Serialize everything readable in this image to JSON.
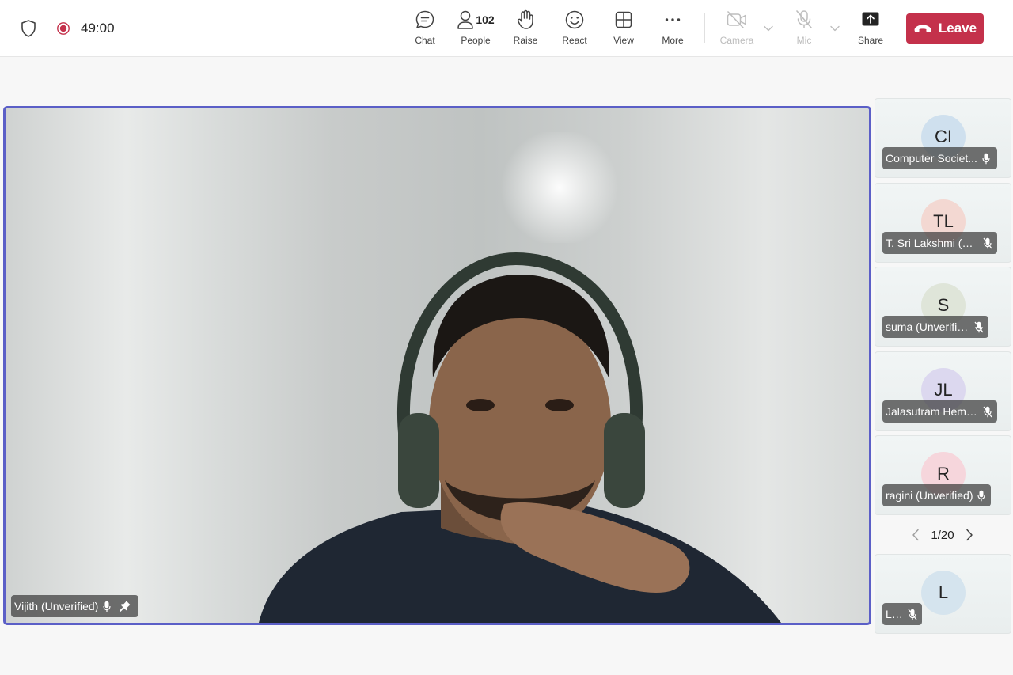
{
  "status": {
    "timer": "49:00"
  },
  "toolbar": {
    "chat": "Chat",
    "people": "People",
    "people_count": "102",
    "raise": "Raise",
    "react": "React",
    "view": "View",
    "more": "More",
    "camera": "Camera",
    "mic": "Mic",
    "share": "Share",
    "leave": "Leave"
  },
  "main_video": {
    "participant": "Vijith (Unverified)"
  },
  "participants": [
    {
      "initials": "CI",
      "name": "Computer Societ...",
      "avatar_color": "#cfe0ee"
    },
    {
      "initials": "TL",
      "name": "T. Sri Lakshmi (U...",
      "avatar_color": "#f3d8d2"
    },
    {
      "initials": "S",
      "name": "suma (Unverified)",
      "avatar_color": "#dfe5d9"
    },
    {
      "initials": "JL",
      "name": "Jalasutram Hema ...",
      "avatar_color": "#dcd8ef"
    },
    {
      "initials": "R",
      "name": "ragini (Unverified)",
      "avatar_color": "#f6d6dc"
    },
    {
      "initials": "L",
      "name": "LIET",
      "avatar_color": "#d5e4ee"
    }
  ],
  "pagination": {
    "page": "1/20"
  },
  "icons": [
    "shield-icon",
    "recording-icon",
    "chat-icon",
    "people-icon",
    "raise-hand-icon",
    "react-icon",
    "view-icon",
    "more-icon",
    "camera-off-icon",
    "mic-off-icon",
    "share-icon",
    "hangup-icon",
    "pin-icon",
    "chevron-left-icon",
    "chevron-right-icon"
  ],
  "colors": {
    "leave": "#c4314b",
    "active_border": "#5b5fc7",
    "recording": "#c4314b"
  }
}
